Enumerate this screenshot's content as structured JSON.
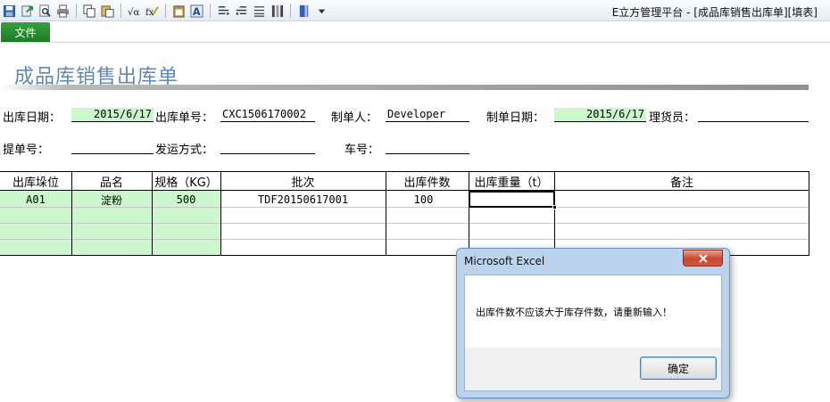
{
  "app": {
    "title": "E立方管理平台 - [成品库销售出库单][填表]"
  },
  "toolbar": {
    "icons": [
      "save-icon",
      "export-icon",
      "print-preview-icon",
      "printer-icon",
      "copy-icon",
      "paste-icon",
      "formula-icon",
      "formula-check-icon",
      "clipboard-icon",
      "font-icon",
      "align-left-icon",
      "align-right-icon",
      "align-justify-icon",
      "column-icon",
      "bookmark-icon",
      "dropdown-arrow-icon"
    ]
  },
  "menu": {
    "file_label": "文件"
  },
  "form": {
    "title": "成品库销售出库单",
    "fields": {
      "out_date_label": "出库日期：",
      "out_date_value": "2015/6/17",
      "out_no_label": "出库单号：",
      "out_no_value": "CXC1506170002",
      "maker_label": "制单人：",
      "maker_value": "Developer",
      "make_date_label": "制单日期：",
      "make_date_value": "2015/6/17",
      "clerk_label": "理货员：",
      "clerk_value": "",
      "bill_no_label": "提单号：",
      "bill_no_value": "",
      "ship_method_label": "发运方式：",
      "ship_method_value": "",
      "car_no_label": "车号：",
      "car_no_value": ""
    }
  },
  "grid": {
    "headers": [
      "出库垛位",
      "品名",
      "规格（KG）",
      "批次",
      "出库件数",
      "出库重量（t）",
      "备注"
    ],
    "rows": [
      [
        "A01",
        "淀粉",
        "500",
        "TDF20150617001",
        "100",
        "",
        ""
      ],
      [
        "",
        "",
        "",
        "",
        "",
        "",
        ""
      ],
      [
        "",
        "",
        "",
        "",
        "",
        "",
        ""
      ],
      [
        "",
        "",
        "",
        "",
        "",
        "",
        ""
      ]
    ]
  },
  "dialog": {
    "title": "Microsoft Excel",
    "message": "出库件数不应该大于库存件数，请重新输入！",
    "ok_label": "确定"
  }
}
